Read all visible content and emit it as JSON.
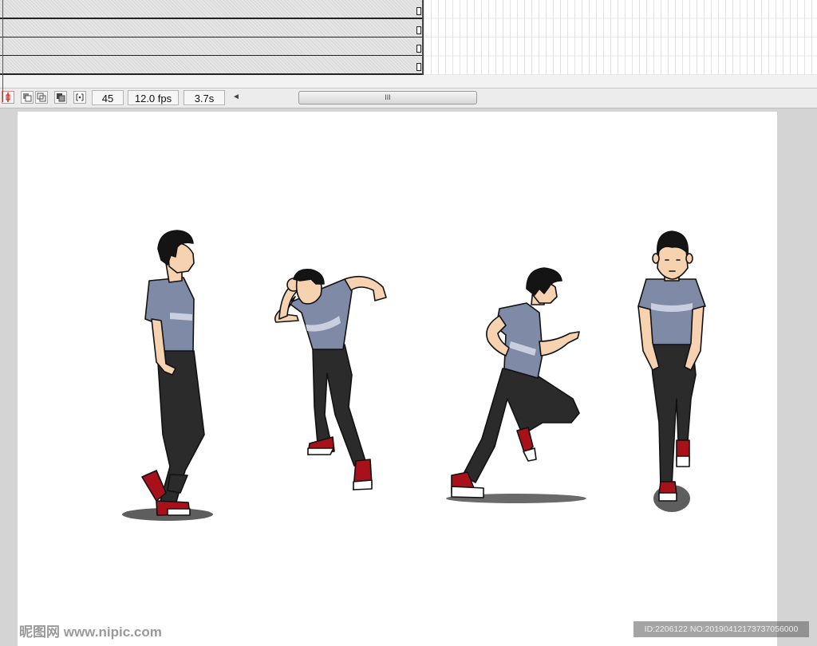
{
  "timeline": {
    "layers": [
      "",
      "",
      "",
      ""
    ],
    "frame_number": "45",
    "frame_rate": "12.0 fps",
    "elapsed_time": "3.7s"
  },
  "scrollbar": {
    "grip": "III",
    "left_arrow": "◄"
  },
  "stage": {
    "figures": [
      "standing-side-pose",
      "crouch-start-pose",
      "running-pose",
      "front-walking-pose"
    ]
  },
  "watermark": {
    "site": "昵图网 www.nipic.com",
    "id_text": "ID:2206122 NO:20190412173737056000"
  },
  "colors": {
    "shirt": "#7f8aa6",
    "pants": "#2b2b2b",
    "shoes": "#a8111a",
    "skin": "#f6d2b0",
    "hair": "#141414",
    "shadow": "#5e5e5e",
    "playhead": "#d42020"
  }
}
